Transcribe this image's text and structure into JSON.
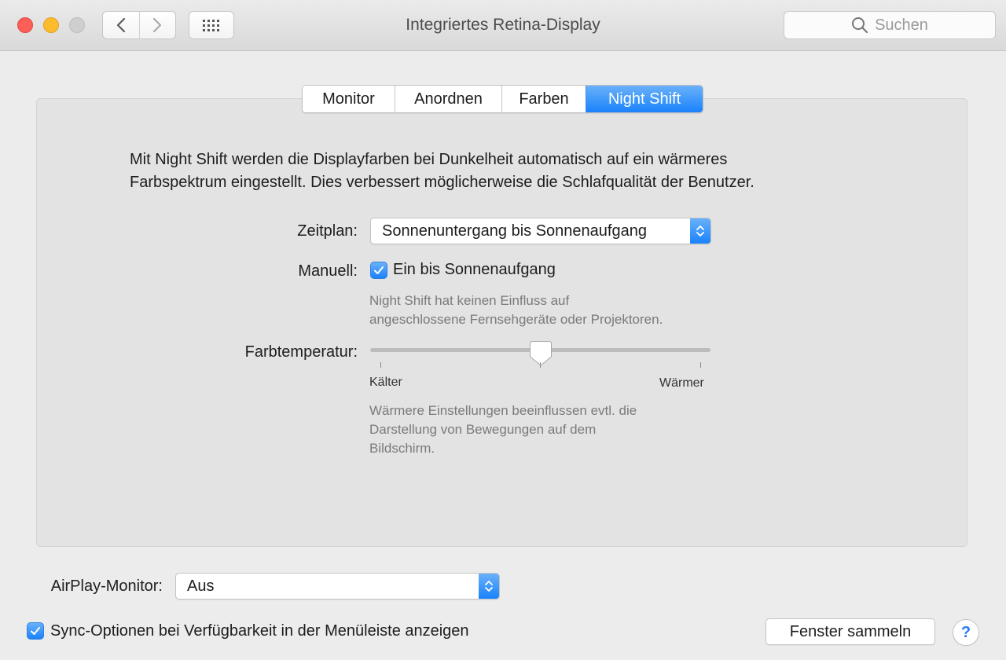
{
  "window": {
    "title": "Integriertes Retina-Display",
    "search_placeholder": "Suchen"
  },
  "tabs": [
    {
      "label": "Monitor",
      "active": false
    },
    {
      "label": "Anordnen",
      "active": false
    },
    {
      "label": "Farben",
      "active": false
    },
    {
      "label": "Night Shift",
      "active": true
    }
  ],
  "night_shift": {
    "intro_lines": [
      "Mit Night Shift werden die Displayfarben bei Dunkelheit automatisch auf ein wärmeres",
      "Farbspektrum eingestellt. Dies verbessert möglicherweise die Schlafqualität der Benutzer."
    ],
    "schedule_label": "Zeitplan:",
    "schedule_value": "Sonnenuntergang bis Sonnenaufgang",
    "manual_label": "Manuell:",
    "manual_checkbox_label": "Ein bis Sonnenaufgang",
    "manual_checked": true,
    "manual_note_lines": [
      "Night Shift hat keinen Einfluss auf",
      "angeschlossene Fernsehgeräte oder Projektoren."
    ],
    "temperature_label": "Farbtemperatur:",
    "temperature_min_label": "Kälter",
    "temperature_max_label": "Wärmer",
    "temperature_fraction": 0.5,
    "temperature_note_lines": [
      "Wärmere Einstellungen beeinflussen evtl. die",
      "Darstellung von Bewegungen auf dem",
      "Bildschirm."
    ]
  },
  "footer": {
    "airplay_label": "AirPlay-Monitor:",
    "airplay_value": "Aus",
    "sync_checkbox_label": "Sync-Optionen bei Verfügbarkeit in der Menüleiste anzeigen",
    "sync_checked": true,
    "gather_button_label": "Fenster sammeln",
    "help_label": "?"
  },
  "colors": {
    "accent": "#1a82fb",
    "close": "#fc5f57",
    "minimize": "#fdbc2e",
    "maximize": "#cfcfcf"
  },
  "icons": [
    "back-arrow-icon",
    "forward-arrow-icon",
    "grid-icon",
    "search-icon",
    "checkmark-icon",
    "select-arrows-icon"
  ]
}
